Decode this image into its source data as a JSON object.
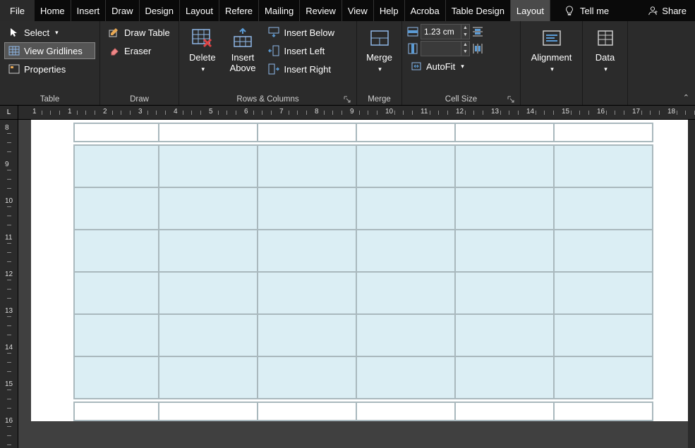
{
  "tabs": {
    "file": "File",
    "items": [
      "Home",
      "Insert",
      "Draw",
      "Design",
      "Layout",
      "Refere",
      "Mailing",
      "Review",
      "View",
      "Help",
      "Acroba",
      "Table Design",
      "Layout"
    ],
    "active_index": 12,
    "tell_me": "Tell me",
    "share": "Share"
  },
  "ribbon": {
    "table": {
      "label": "Table",
      "select": "Select",
      "view_gridlines": "View Gridlines",
      "properties": "Properties"
    },
    "draw": {
      "label": "Draw",
      "draw_table": "Draw Table",
      "eraser": "Eraser"
    },
    "rows_cols": {
      "label": "Rows & Columns",
      "delete": "Delete",
      "insert_above": "Insert\nAbove",
      "insert_below": "Insert Below",
      "insert_left": "Insert Left",
      "insert_right": "Insert Right"
    },
    "merge": {
      "label": "Merge",
      "merge": "Merge"
    },
    "cell_size": {
      "label": "Cell Size",
      "height": "1.23 cm",
      "width": "",
      "autofit": "AutoFit"
    },
    "alignment": {
      "label": "Alignment"
    },
    "data": {
      "label": "Data"
    }
  },
  "ruler": {
    "corner": "L",
    "h_numbers": [
      1,
      1,
      2,
      3,
      4,
      5,
      6,
      7,
      8,
      9,
      10,
      11,
      12,
      13,
      14,
      15,
      16,
      17,
      18
    ],
    "v_numbers": [
      8,
      9,
      10,
      11,
      12,
      13,
      14,
      15,
      16
    ]
  },
  "document": {
    "table_cols": 6,
    "table_rows": 7
  }
}
